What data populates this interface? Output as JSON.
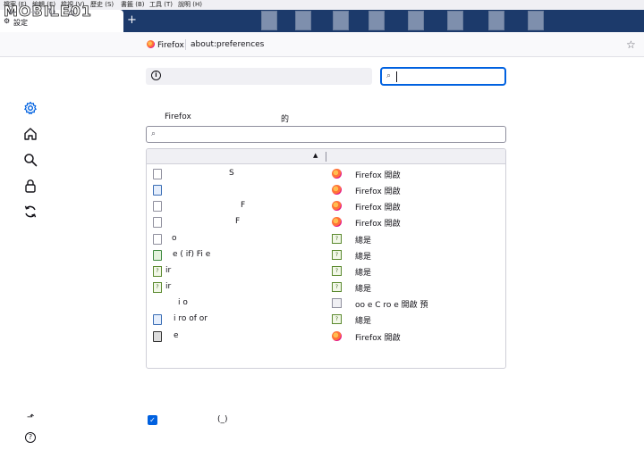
{
  "menubar": {
    "items": [
      "檔案 (F)",
      "編輯 (E)",
      "檢視 (V)",
      "歷史 (S)",
      "書籤 (B)",
      "工具 (T)",
      "說明 (H)"
    ]
  },
  "logo_text": "MOBILE01",
  "tab": {
    "label": "設定",
    "new_tab": "+"
  },
  "navbar": {
    "identity_label": "Firefox",
    "url": "about:preferences"
  },
  "notice": {
    "text": ""
  },
  "search": {
    "placeholder": ""
  },
  "description": {
    "left": "Firefox",
    "right": "的"
  },
  "filter": {
    "placeholder": ""
  },
  "table": {
    "type_header": "",
    "action_header": "",
    "rows": [
      {
        "type": "S",
        "action": "Firefox 開啟",
        "type_icon": "doc",
        "action_icon": "firefox-icon"
      },
      {
        "type": "",
        "action": "Firefox 開啟",
        "type_icon": "doc-blue",
        "action_icon": "firefox-icon"
      },
      {
        "type": "F",
        "action": "Firefox 開啟",
        "type_icon": "doc",
        "action_icon": "firefox-icon"
      },
      {
        "type": "F",
        "action": "Firefox 開啟",
        "type_icon": "doc",
        "action_icon": "firefox-icon"
      },
      {
        "type": "o",
        "action": "總是",
        "type_icon": "doc",
        "action_icon": "ask-icon"
      },
      {
        "type": "e ( if) Fi e",
        "action": "總是",
        "type_icon": "doc-green",
        "action_icon": "ask-icon"
      },
      {
        "type": "ir",
        "action": "總是",
        "type_icon": "generic",
        "action_icon": "ask-icon"
      },
      {
        "type": "ir",
        "action": "總是",
        "type_icon": "generic",
        "action_icon": "ask-icon"
      },
      {
        "type": "i o",
        "action": "oo e C ro e 開啟 預",
        "type_icon": "none",
        "action_icon": "system-app-icon"
      },
      {
        "type": "i ro of or",
        "action": "總是",
        "type_icon": "doc-blue",
        "action_icon": "ask-icon"
      },
      {
        "type": "e",
        "action": "Firefox 開啟",
        "type_icon": "doc-dark",
        "action_icon": "firefox-icon"
      }
    ]
  },
  "footer": {
    "check_label": "(_)",
    "checked": true
  },
  "colors": {
    "accent": "#0061e0",
    "titlebar": "#1c3a6b"
  }
}
